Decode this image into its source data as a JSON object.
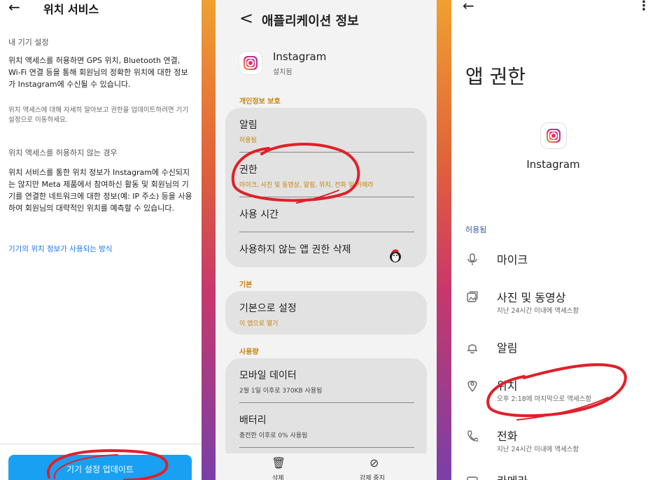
{
  "left_panel": {
    "title": "위치 서비스",
    "back_label": "←",
    "section1": "내 기기 설정",
    "para1": "위치 액세스를 허용하면 GPS 위치, Bluetooth 연결, Wi-Fi 연결 등을 통해 회원님의 정확한 위치에 대한 정보가 Instagram에 수신될 수 있습니다.",
    "small_note": "위치 액세스에 대해 자세히 알아보고 권한을 업데이트하려면 기기 설정으로 이동하세요.",
    "section2": "위치 액세스를 허용하지 않는 경우",
    "para2": "위치 서비스를 통한 위치 정보가 Instagram에 수신되지는 않지만 Meta 제품에서 참여하신 활동 및 회원님의 기기를 연결한 네트워크에 대한 정보(예: IP 주소) 등을 사용하여 회원님의 대략적인 위치를 예측할 수 있습니다.",
    "link": "기기의 위치 정보가 사용되는 방식",
    "button": "기기 설정 업데이트"
  },
  "middle_panel": {
    "back_label": "<",
    "title": "애플리케이션 정보",
    "app_name": "Instagram",
    "app_status": "설치됨",
    "section_privacy": "개인정보 보호",
    "items_privacy": [
      {
        "title": "알림",
        "sub": "허용됨"
      },
      {
        "title": "권한",
        "sub": "마이크, 사진 및 동영상, 알림, 위치, 전화 및 카메라"
      },
      {
        "title": "사용 시간",
        "sub": ""
      },
      {
        "title": "사용하지 않는 앱 권한 삭제",
        "sub": ""
      }
    ],
    "section_default": "기본",
    "items_default": [
      {
        "title": "기본으로 설정",
        "sub": "이 앱으로 열기"
      }
    ],
    "section_usage": "사용량",
    "items_usage": [
      {
        "title": "모바일 데이터",
        "sub": "2월 1일 이후로 370KB 사용됨"
      },
      {
        "title": "배터리",
        "sub": "충전한 이후로 0% 사용됨"
      }
    ],
    "bottom": {
      "delete_label": "삭제",
      "stop_label": "강제 중지"
    }
  },
  "right_panel": {
    "back_label": "←",
    "more_label": "⋮",
    "title": "앱 권한",
    "app_name": "Instagram",
    "section_allowed": "허용됨",
    "permissions": [
      {
        "title": "마이크",
        "sub": "",
        "icon": "mic-icon"
      },
      {
        "title": "사진 및 동영상",
        "sub": "지난 24시간 이내에 액세스함",
        "icon": "photo-icon"
      },
      {
        "title": "알림",
        "sub": "",
        "icon": "bell-icon"
      },
      {
        "title": "위치",
        "sub": "오후 2:18에 마지막으로 액세스함",
        "icon": "location-icon"
      },
      {
        "title": "전화",
        "sub": "지난 24시간 이내에 액세스함",
        "icon": "phone-icon"
      },
      {
        "title": "카메라",
        "sub": "",
        "icon": "camera-icon"
      }
    ]
  },
  "colors": {
    "accent_orange": "#c8820a",
    "primary_blue": "#1aa0f2",
    "link_blue": "#1877f2",
    "annotation_red": "#e0202a"
  }
}
